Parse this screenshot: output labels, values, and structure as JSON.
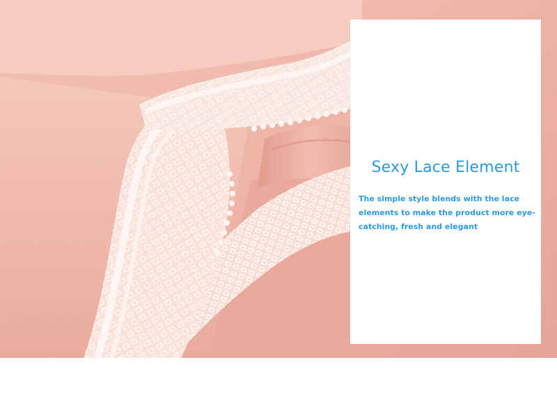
{
  "colors": {
    "accent": "#2b9ae6",
    "fabric": "#eeb4a6",
    "lace": "#fbf3ef",
    "panel": "#ffffff"
  },
  "product_image": {
    "subject": "pink-fabric-with-white-lace-trim"
  },
  "info_panel": {
    "title": "Sexy Lace Element",
    "body": "The simple style blends with the lace elements to make the product more eye-catching, fresh and elegant"
  }
}
